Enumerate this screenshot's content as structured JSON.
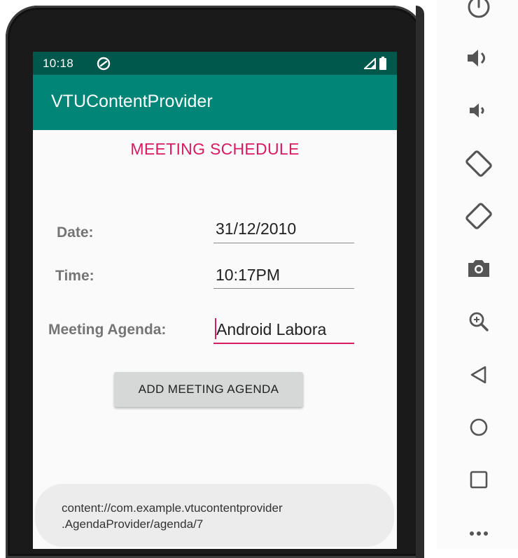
{
  "status_bar": {
    "time": "10:18",
    "icons": [
      "notification-sync-icon",
      "signal-icon",
      "battery-icon"
    ]
  },
  "app_bar": {
    "title": "VTUContentProvider"
  },
  "form": {
    "heading": "MEETING SCHEDULE",
    "date_label": "Date:",
    "date_value": "31/12/2010",
    "time_label": "Time:",
    "time_value": "10:17PM",
    "agenda_label": "Meeting Agenda:",
    "agenda_value": "Android Labora",
    "add_button_label": "ADD MEETING AGENDA"
  },
  "toast": {
    "line1": "content://com.example.vtucontentprovider",
    "line2": ".AgendaProvider/agenda/7"
  },
  "emulator_controls": [
    "power-icon",
    "volume-up-icon",
    "volume-down-icon",
    "rotate-left-icon",
    "rotate-right-icon",
    "camera-icon",
    "zoom-icon",
    "back-icon",
    "home-icon",
    "overview-icon",
    "more-icon"
  ],
  "colors": {
    "status_bar": "#00574b",
    "app_bar": "#008577",
    "accent": "#d81b60",
    "screen_bg": "#fafafa"
  }
}
